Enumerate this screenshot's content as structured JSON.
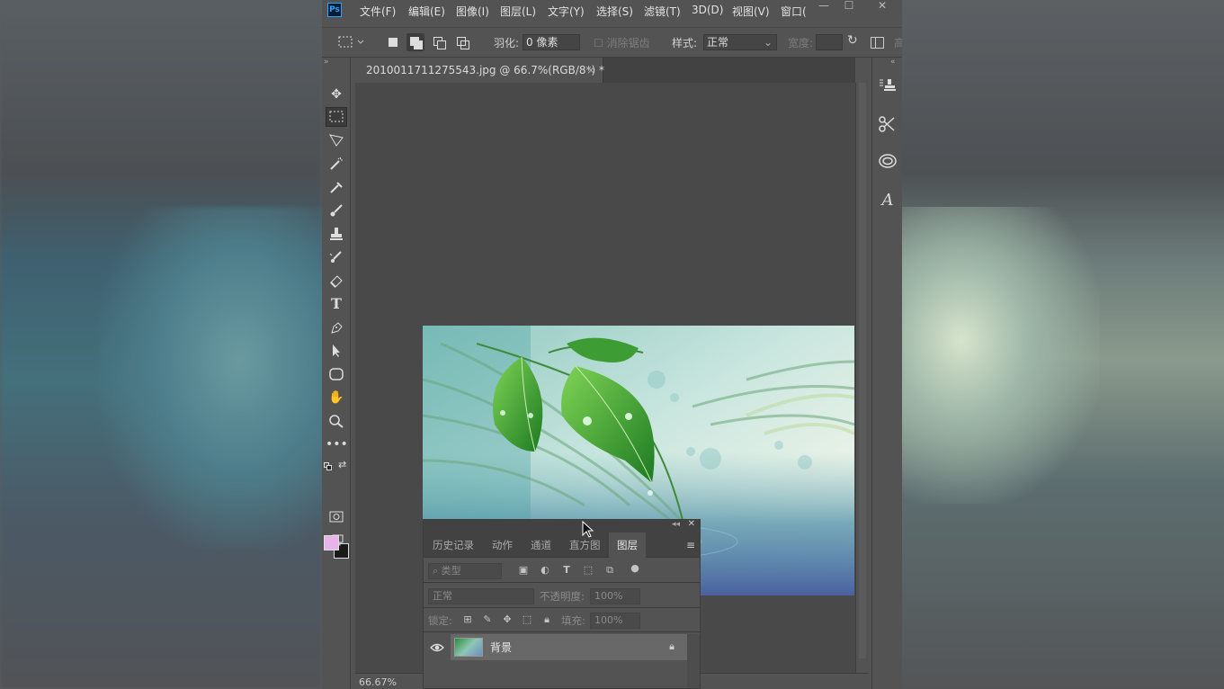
{
  "menu": {
    "logo": "Ps",
    "items": [
      "文件(F)",
      "编辑(E)",
      "图像(I)",
      "图层(L)",
      "文字(Y)",
      "选择(S)",
      "滤镜(T)",
      "3D(D)",
      "视图(V)",
      "窗口("
    ]
  },
  "options": {
    "feather_label": "羽化:",
    "feather_value": "0 像素",
    "antialias_label": "消除锯齿",
    "style_label": "样式:",
    "style_value": "正常",
    "width_label": "宽度:",
    "height_partial": "高"
  },
  "document": {
    "tab_title": "2010011711275543.jpg @ 66.7%(RGB/8*) *",
    "close": "×",
    "zoom": "66.67%"
  },
  "colors": {
    "foreground": "#e8b2ea",
    "background": "#1a1a1a",
    "accent": "#2fa3f5"
  },
  "tools": [
    "move-icon",
    "marquee-icon",
    "lasso-icon",
    "magic-wand-icon",
    "eyedropper-icon",
    "brush-icon",
    "stamp-icon",
    "eraser-icon",
    "paint-bucket-icon",
    "type-icon",
    "pen-icon",
    "path-select-icon",
    "shape-icon",
    "hand-icon",
    "zoom-icon",
    "more-icon"
  ],
  "layers_panel": {
    "tabs": [
      "历史记录",
      "动作",
      "通道",
      "直方图",
      "图层"
    ],
    "active_tab": "图层",
    "filter_placeholder": "类型",
    "blend_mode": "正常",
    "opacity_label": "不透明度:",
    "opacity_value": "100%",
    "lock_label": "锁定:",
    "fill_label": "填充:",
    "fill_value": "100%",
    "layers": [
      {
        "name": "背景",
        "locked": true,
        "visible": true
      }
    ]
  }
}
